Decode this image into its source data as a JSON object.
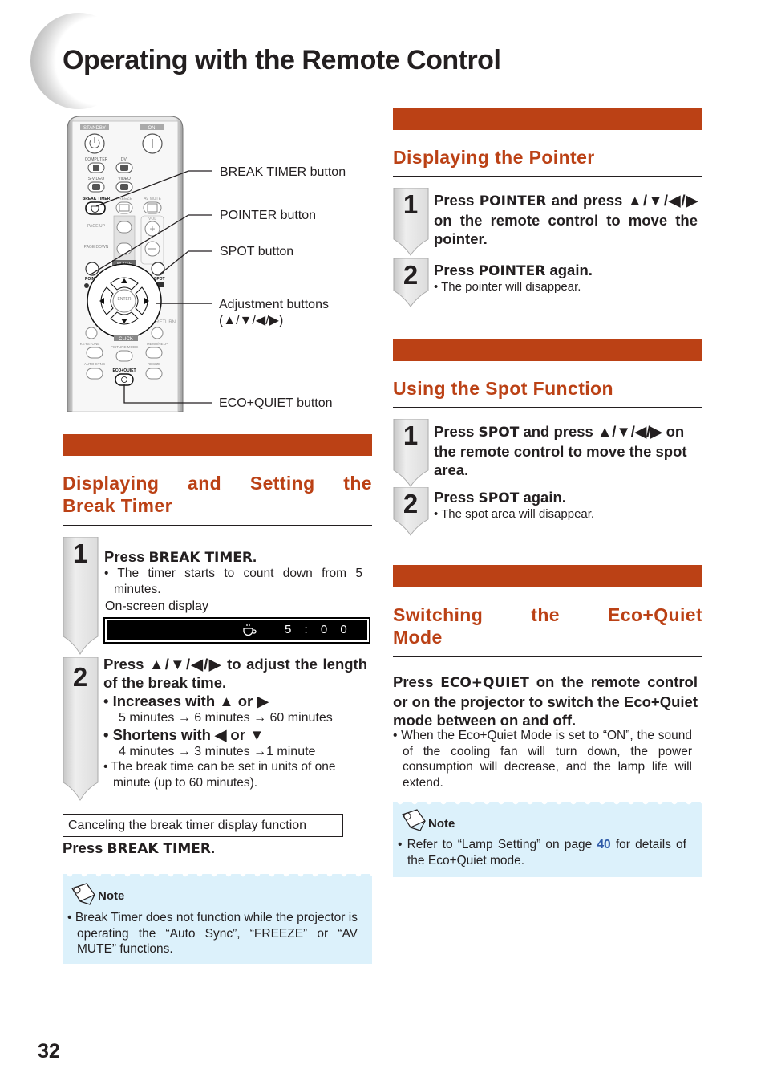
{
  "page": {
    "title": "Operating with the Remote Control",
    "page_number": "32",
    "accent_color": "#bb4115",
    "note_bg_color": "#dcf1fb",
    "link_color": "#2e5aa8"
  },
  "remote": {
    "labels": {
      "standby": "STANDBY",
      "on": "ON",
      "computer": "COMPUTER",
      "dvi": "DVI",
      "svideo": "S-VIDEO",
      "video": "VIDEO",
      "break_timer": "BREAK TIMER",
      "freeze": "FREEZE",
      "av_mute": "AV MUTE",
      "vol": "VOL",
      "page_up": "PAGE UP",
      "page_down": "PAGE DOWN",
      "mouse": "MOUSE",
      "pointer": "POINTER",
      "spot": "SPOT",
      "enter": "ENTER",
      "return": "RETURN",
      "click": "CLICK",
      "keystone": "KEYSTONE",
      "picture_mode": "PICTURE MODE",
      "menu_help": "MENU/HELP",
      "auto_sync": "AUTO SYNC",
      "eco_quiet": "ECO+QUIET",
      "resize": "RESIZE"
    },
    "callouts": [
      {
        "label": "BREAK TIMER button"
      },
      {
        "label": "POINTER button"
      },
      {
        "label": "SPOT button"
      },
      {
        "label": "Adjustment buttons",
        "label2": "(▲/▼/◀/▶)"
      },
      {
        "label": "ECO+QUIET button"
      }
    ]
  },
  "break_timer": {
    "title_line1": "Displaying and Setting the",
    "title_line2": "Break Timer",
    "step1": {
      "number": "1",
      "prefix": "Press ",
      "key": "BREAK TIMER",
      "suffix": ".",
      "bullet": "• The timer starts to count down from 5 minutes.",
      "osd_label": "On-screen display",
      "osd_time": "5 : 0 0"
    },
    "step2": {
      "number": "2",
      "head": "Press ▲/▼/◀/▶ to adjust the length of the break time.",
      "increase_head": "•  Increases with ▲ or ▶",
      "increase_seq": "5 minutes → 6 minutes → 60 minutes",
      "shorten_head": "•  Shortens with ◀ or ▼",
      "shorten_seq": "4 minutes → 3 minutes →1 minute",
      "bullet": "• The break time can be set in units of one minute (up to 60 minutes)."
    },
    "cancel_box": "Canceling the break timer display function",
    "cancel_prefix": "Press ",
    "cancel_key": "BREAK TIMER",
    "cancel_suffix": ".",
    "note": {
      "heading": "Note",
      "text": "• Break Timer does not function while the projector is operating the “Auto Sync”, “FREEZE” or “AV MUTE” functions."
    }
  },
  "pointer": {
    "title": "Displaying the Pointer",
    "step1": {
      "number": "1",
      "prefix": "Press ",
      "key": "POINTER",
      "suffix": " and press ▲/▼/◀/▶ on the remote control to move the pointer."
    },
    "step2": {
      "number": "2",
      "prefix": "Press ",
      "key": "POINTER",
      "suffix": " again.",
      "bullet": "• The pointer will disappear."
    }
  },
  "spot": {
    "title": "Using the Spot Function",
    "step1": {
      "number": "1",
      "prefix": "Press ",
      "key": "SPOT",
      "suffix": " and press ▲/▼/◀/▶ on the remote control to move the spot area."
    },
    "step2": {
      "number": "2",
      "prefix": "Press ",
      "key": "SPOT",
      "suffix": " again.",
      "bullet": "• The spot area will disappear."
    }
  },
  "eco": {
    "title_line1": "Switching the Eco+Quiet",
    "title_line2": "Mode",
    "prefix": "Press ",
    "key": "ECO+QUIET",
    "suffix": " on the remote control or on the projector to switch the Eco+Quiet mode between on and off.",
    "bullet": "• When the Eco+Quiet Mode is set to “ON”, the sound of the cooling fan will turn down, the power consumption will decrease, and the lamp life will extend.",
    "note": {
      "heading": "Note",
      "text_before": "• Refer to “Lamp Setting” on page ",
      "link": "40",
      "text_after": " for details of the Eco+Quiet mode."
    }
  }
}
